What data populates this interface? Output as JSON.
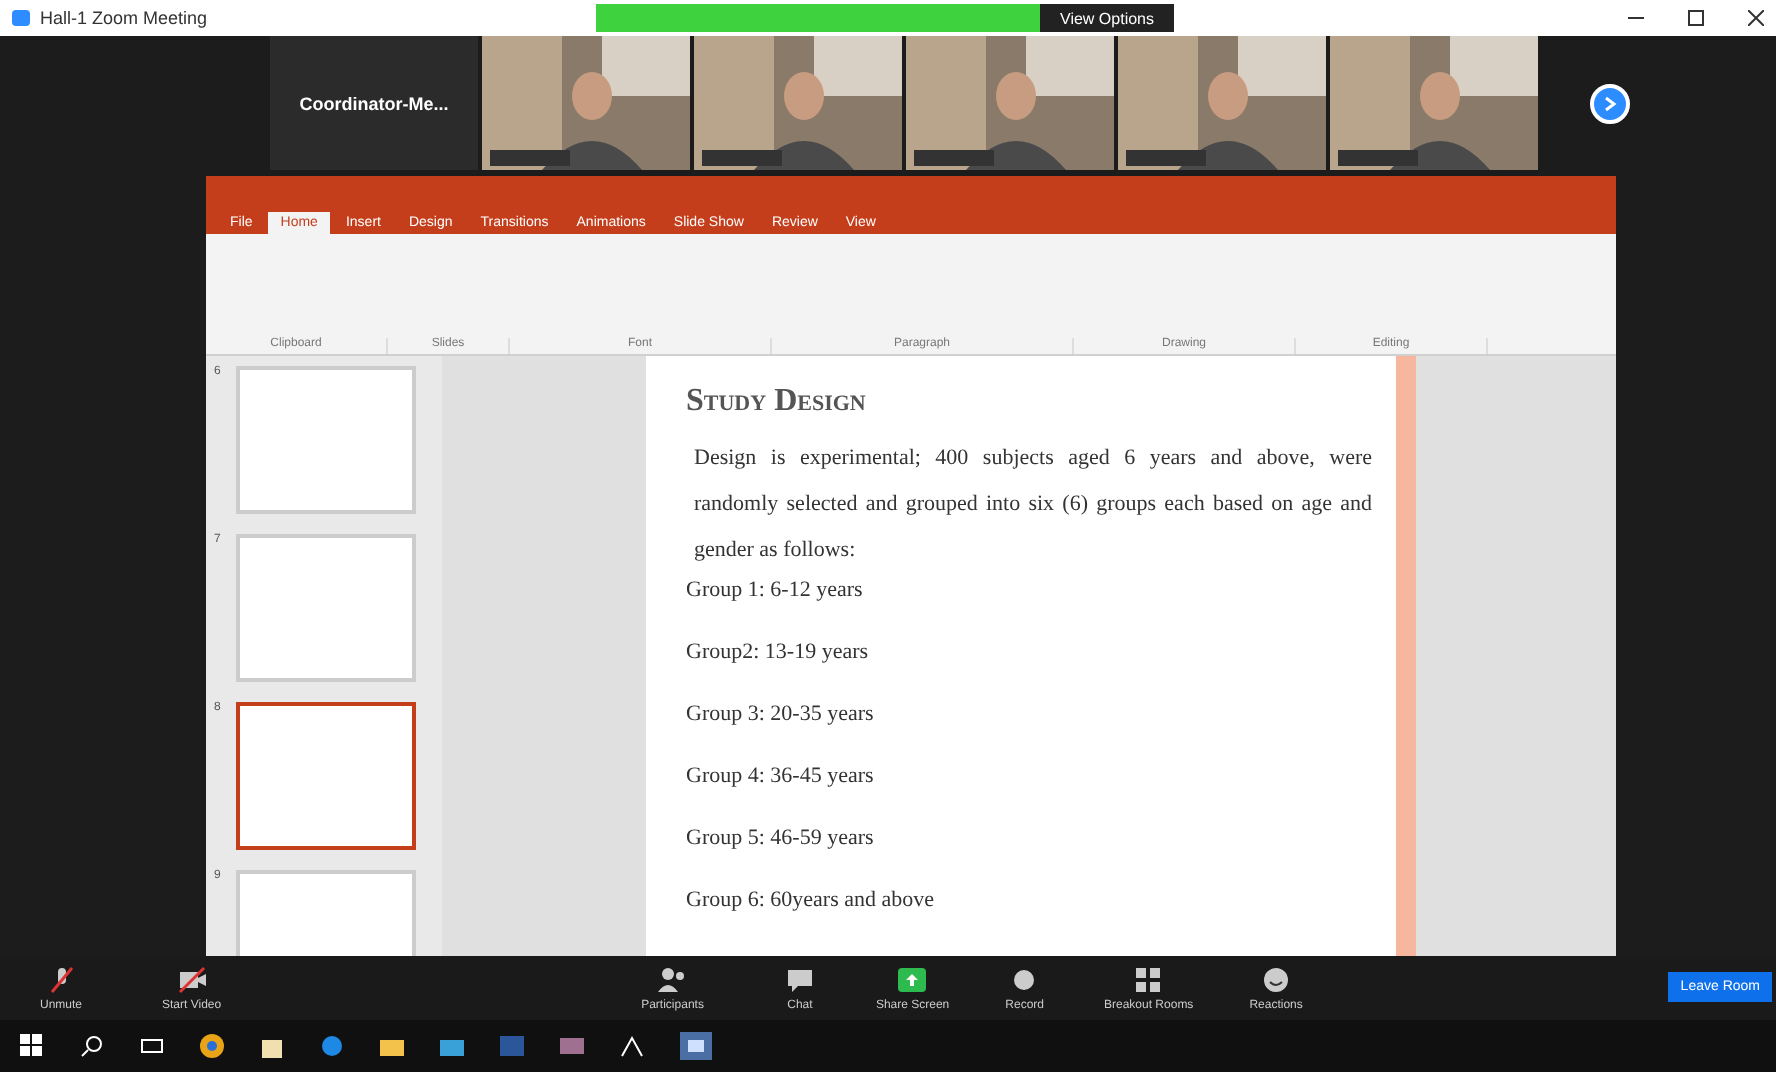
{
  "window": {
    "title": "Hall-1 Zoom Meeting"
  },
  "share_banner": {
    "view_options": "View Options"
  },
  "videos": [
    {
      "kind": "name",
      "name": "Coordinator-Me..."
    },
    {
      "kind": "picture"
    },
    {
      "kind": "picture"
    },
    {
      "kind": "picture"
    },
    {
      "kind": "picture"
    },
    {
      "kind": "picture"
    }
  ],
  "powerpoint": {
    "tabs": [
      {
        "label": "File",
        "selected": false
      },
      {
        "label": "Home",
        "selected": true
      },
      {
        "label": "Insert",
        "selected": false
      },
      {
        "label": "Design",
        "selected": false
      },
      {
        "label": "Transitions",
        "selected": false
      },
      {
        "label": "Animations",
        "selected": false
      },
      {
        "label": "Slide Show",
        "selected": false
      },
      {
        "label": "Review",
        "selected": false
      },
      {
        "label": "View",
        "selected": false
      }
    ],
    "ribbon_groups": [
      "Clipboard",
      "Slides",
      "Font",
      "Paragraph",
      "Drawing",
      "Editing"
    ],
    "thumbnails": [
      {
        "number": "6",
        "selected": false
      },
      {
        "number": "7",
        "selected": false
      },
      {
        "number": "8",
        "selected": true
      },
      {
        "number": "9",
        "selected": false
      }
    ],
    "slide": {
      "title": "Study Design",
      "paragraph": "Design is experimental; 400 subjects aged 6 years and above, were randomly selected and grouped into six (6) groups each based on age and gender as follows:",
      "groups": [
        "Group 1: 6-12 years",
        "Group2: 13-19 years",
        "Group 3: 20-35 years",
        "Group 4: 36-45 years",
        "Group 5: 46-59 years",
        "Group 6: 60years and above"
      ]
    }
  },
  "meeting_controls": [
    {
      "label": "Unmute",
      "kind": "mic"
    },
    {
      "label": "Start Video",
      "kind": "video"
    },
    {
      "label": "Participants",
      "kind": "people"
    },
    {
      "label": "Chat",
      "kind": "chat"
    },
    {
      "label": "Share Screen",
      "kind": "share"
    },
    {
      "label": "Record",
      "kind": "record"
    },
    {
      "label": "Breakout Rooms",
      "kind": "rooms"
    },
    {
      "label": "Reactions",
      "kind": "reactions"
    }
  ],
  "leave_button": "Leave Room"
}
